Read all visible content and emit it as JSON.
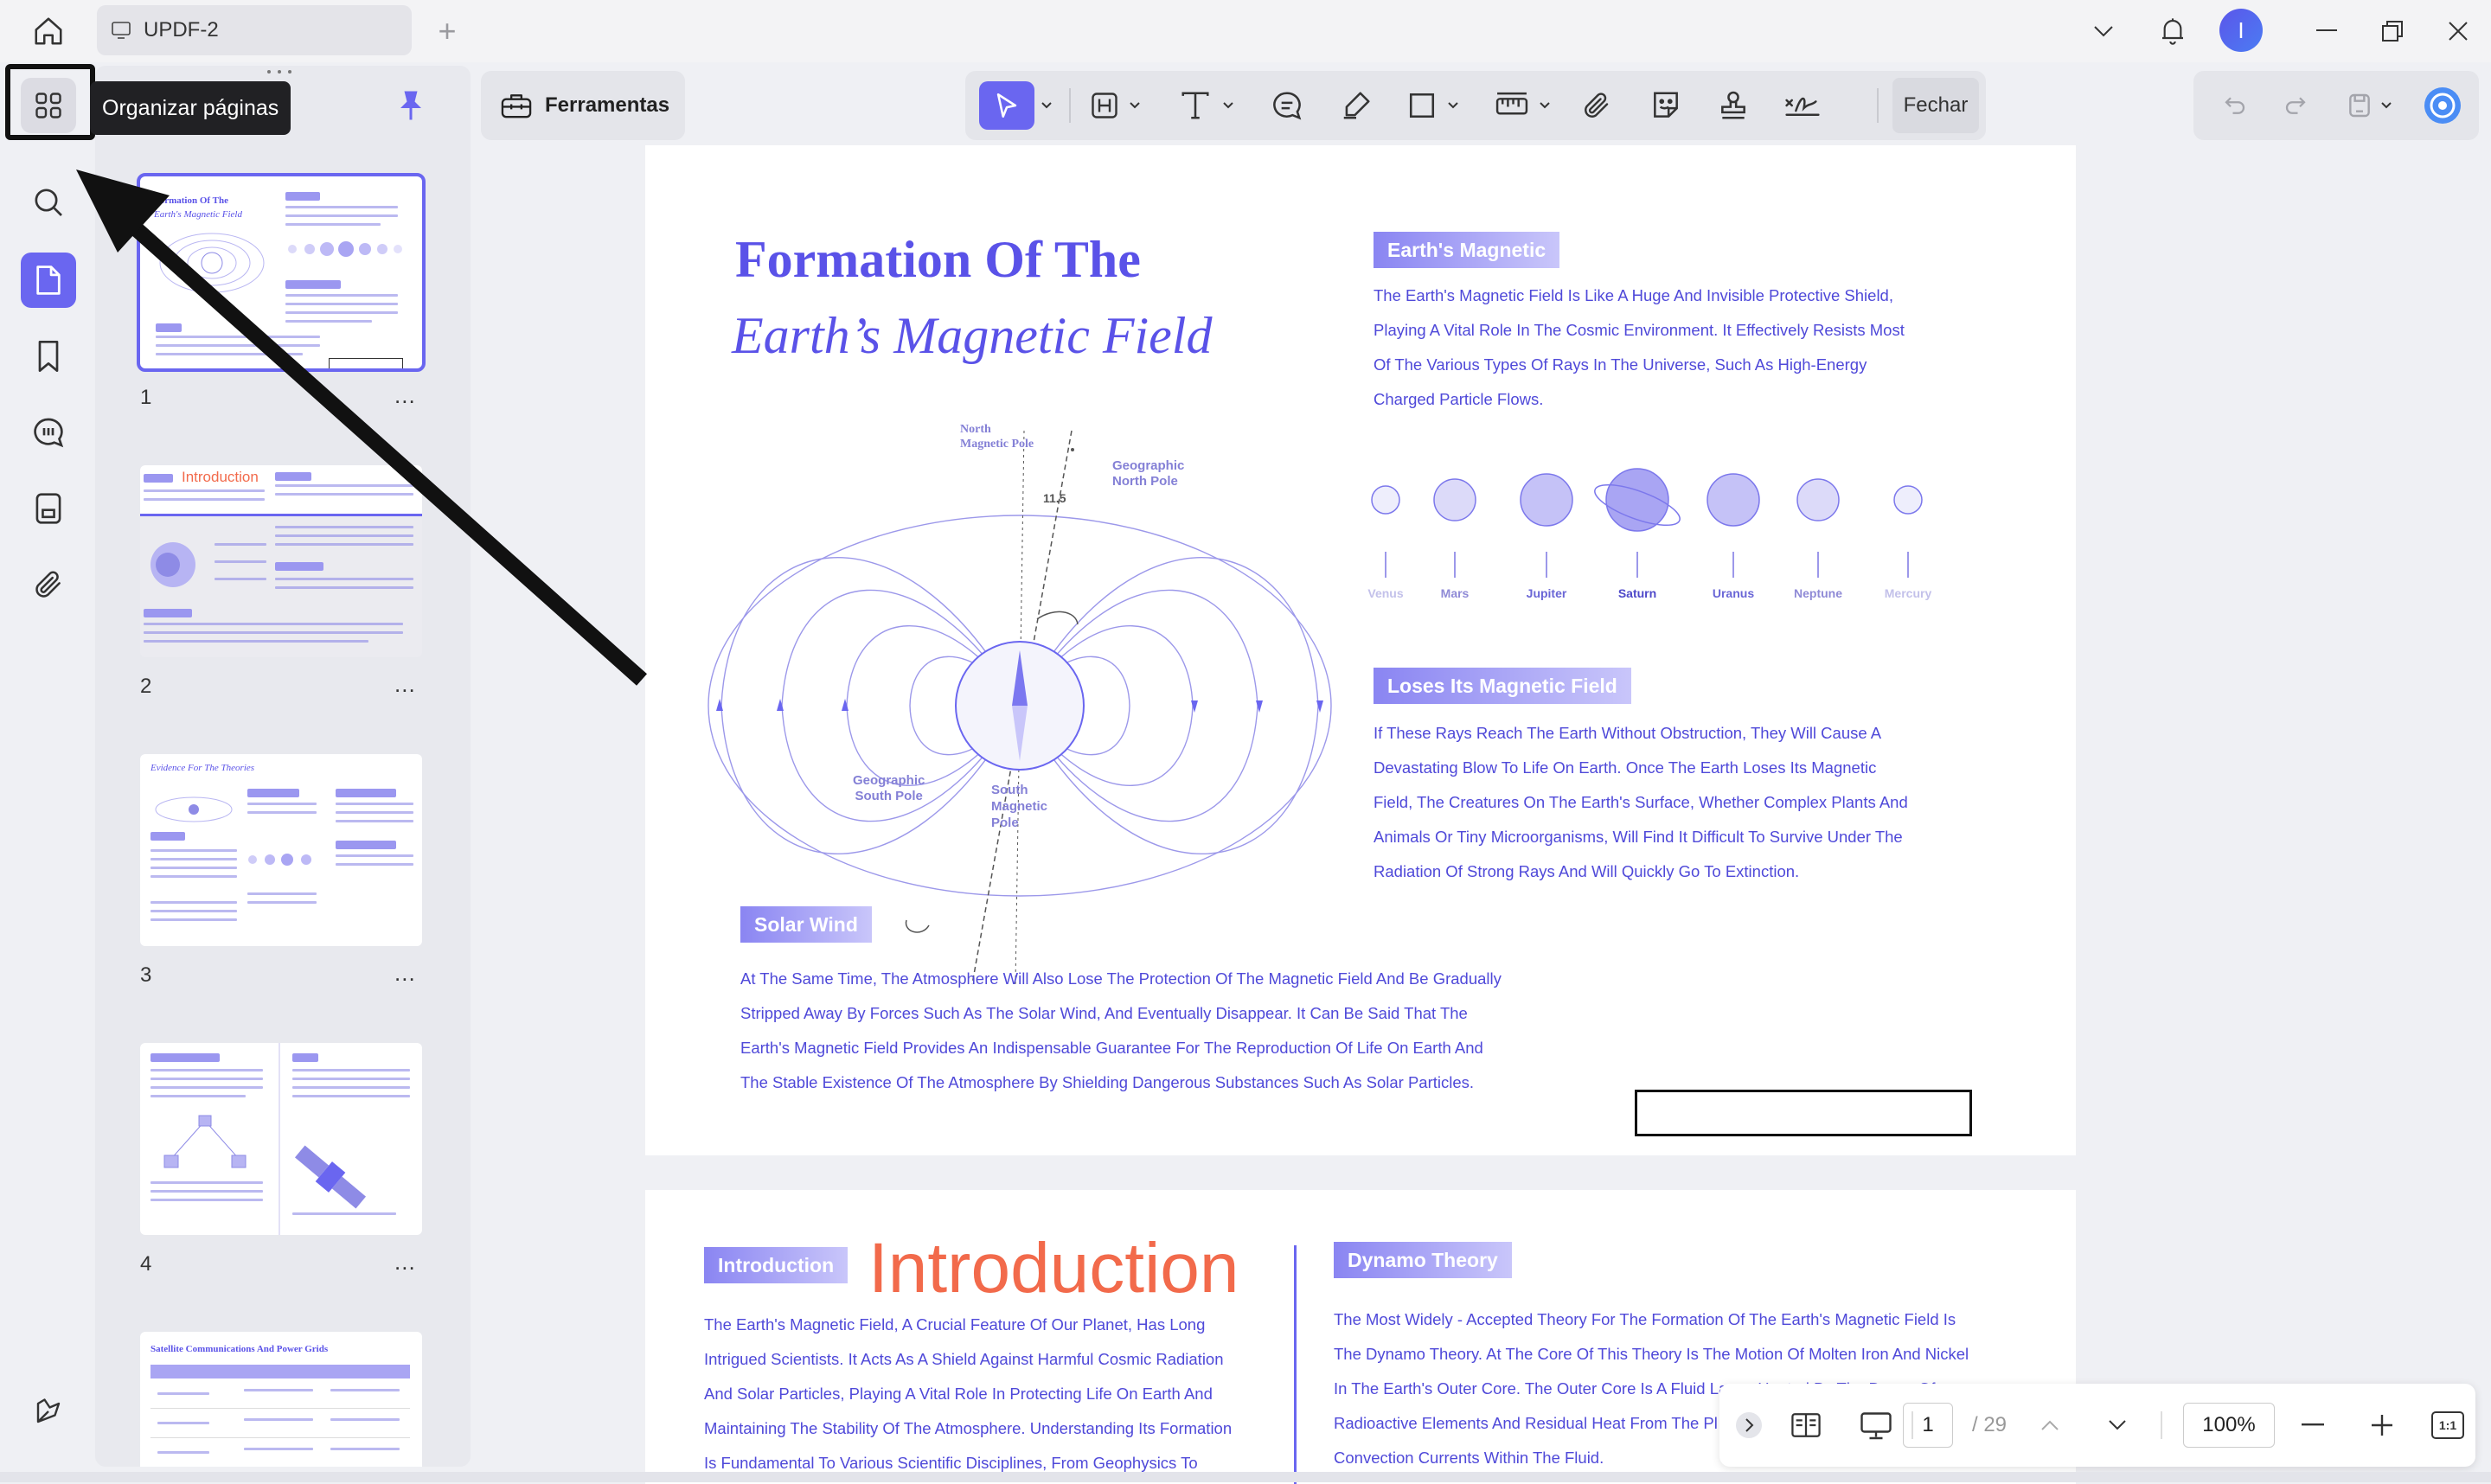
{
  "titlebar": {
    "tab_title": "UPDF-2",
    "new_tab_label": "+",
    "avatar_initial": "I"
  },
  "left_rail": {
    "items": [
      {
        "name": "organize-pages",
        "icon": "grid-icon",
        "active": false
      },
      {
        "name": "search",
        "icon": "search-icon",
        "active": false
      },
      {
        "name": "pages",
        "icon": "page-icon",
        "active": true
      },
      {
        "name": "bookmarks",
        "icon": "bookmark-icon",
        "active": false
      },
      {
        "name": "comments",
        "icon": "comment-icon",
        "active": false
      },
      {
        "name": "attachments-panel",
        "icon": "stack-icon",
        "active": false
      },
      {
        "name": "attachments",
        "icon": "paperclip-icon",
        "active": false
      },
      {
        "name": "feather",
        "icon": "feather-icon",
        "active": false
      }
    ],
    "tooltip": "Organizar páginas"
  },
  "thumbnails": {
    "pages": [
      {
        "number": "1",
        "more": "...",
        "selected": true,
        "title1": "Formation Of The",
        "title2": "Earth's Magnetic Field"
      },
      {
        "number": "2",
        "more": "...",
        "selected": false,
        "title1": "Introduction"
      },
      {
        "number": "3",
        "more": "...",
        "selected": false,
        "title1": "Evidence For The Theories"
      },
      {
        "number": "4",
        "more": "...",
        "selected": false
      },
      {
        "title1": "Satellite Communications And Power Grids"
      }
    ]
  },
  "toolbar": {
    "tools_label": "Ferramentas",
    "close_label": "Fechar"
  },
  "page1": {
    "title_line1": "Formation Of The",
    "title_line2": "Earth’s Magnetic Field",
    "diagram_labels": {
      "north_magnetic_pole": [
        "North",
        "Magnetic Pole"
      ],
      "geographic_north_pole": [
        "Geographic",
        "North Pole"
      ],
      "angle": "11.5",
      "geographic_south_pole": [
        "Geographic",
        "South Pole"
      ],
      "south_magnetic_pole": [
        "South",
        "Magnetic",
        "Pole"
      ]
    },
    "earths_magnetic": {
      "heading": "Earth's Magnetic",
      "lines": [
        "The Earth's Magnetic Field Is Like A Huge And Invisible Protective Shield,",
        "Playing A Vital Role In The Cosmic Environment. It Effectively Resists Most",
        "Of The Various Types Of Rays In The Universe, Such As High-Energy",
        "Charged Particle Flows."
      ]
    },
    "planets": [
      "Venus",
      "Mars",
      "Jupiter",
      "Saturn",
      "Uranus",
      "Neptune",
      "Mercury"
    ],
    "loses_field": {
      "heading": "Loses Its Magnetic Field",
      "lines": [
        "If These Rays Reach The Earth Without Obstruction, They Will Cause A",
        "Devastating Blow To Life On Earth. Once The Earth Loses Its Magnetic",
        "Field, The Creatures On The Earth's Surface, Whether Complex Plants And",
        "Animals Or Tiny Microorganisms, Will Find It Difficult To Survive Under The",
        "Radiation Of Strong Rays And Will Quickly Go To Extinction."
      ]
    },
    "solar_wind": {
      "heading": "Solar Wind",
      "lines": [
        "At The Same Time, The Atmosphere Will Also Lose The Protection Of The Magnetic Field And Be Gradually",
        "Stripped Away By Forces Such As The Solar Wind, And Eventually Disappear. It Can Be Said That The",
        "Earth's Magnetic Field Provides An Indispensable Guarantee For The Reproduction Of Life On Earth And",
        "The Stable Existence Of The Atmosphere By Shielding Dangerous Substances Such As Solar Particles."
      ]
    }
  },
  "page2": {
    "intro_chip": "Introduction",
    "intro_title": "Introduction",
    "intro_lines": [
      "The Earth's Magnetic Field, A Crucial Feature Of Our Planet, Has Long",
      "Intrigued Scientists. It Acts As A Shield Against Harmful Cosmic Radiation",
      "And Solar Particles, Playing A Vital Role In Protecting Life On Earth And",
      "Maintaining The Stability Of The Atmosphere. Understanding Its Formation",
      "Is Fundamental To Various Scientific Disciplines, From Geophysics To"
    ],
    "dynamo_heading": "Dynamo Theory",
    "dynamo_lines": [
      "The Most Widely - Accepted Theory For The Formation Of The Earth's Magnetic Field Is",
      "The Dynamo Theory. At The Core Of This Theory Is The Motion Of Molten Iron And Nickel",
      "In The Earth's Outer Core. The Outer Core Is A Fluid Layer, Heated By The Decay Of",
      "Radioactive Elements And Residual Heat From The Pl",
      "Convection Currents Within The Fluid."
    ]
  },
  "bottom_nav": {
    "current_page": "1",
    "total_pages": "/ 29",
    "zoom": "100%",
    "fit_label": "1:1"
  },
  "colors": {
    "accent": "#6a66f0",
    "text_blue": "#4f49d9",
    "title_blue": "#5a52e8",
    "intro_orange": "#f26a4b"
  }
}
